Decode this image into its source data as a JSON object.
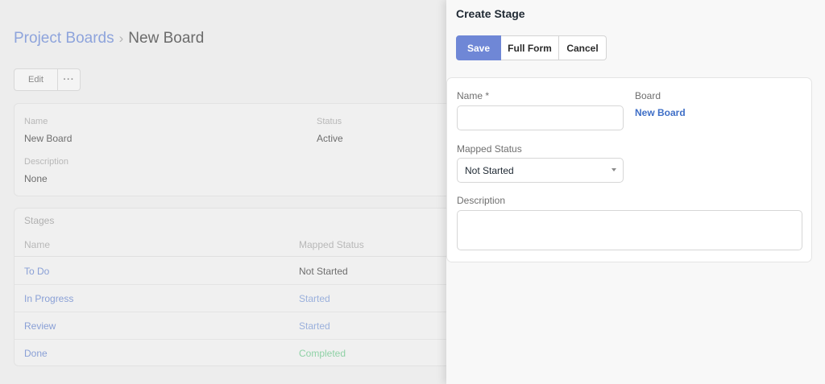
{
  "breadcrumb": {
    "parent": "Project Boards",
    "separator": "›",
    "current": "New Board"
  },
  "toolbar": {
    "edit_label": "Edit",
    "more_label": "···"
  },
  "details": {
    "name_label": "Name",
    "name_value": "New Board",
    "status_label": "Status",
    "status_value": "Active",
    "description_label": "Description",
    "description_value": "None"
  },
  "stages": {
    "title": "Stages",
    "columns": [
      "Name",
      "Mapped Status"
    ],
    "rows": [
      {
        "name": "To Do",
        "status": "Not Started",
        "status_color": "#6e6e6e"
      },
      {
        "name": "In Progress",
        "status": "Started",
        "status_color": "#9ab0dc"
      },
      {
        "name": "Review",
        "status": "Started",
        "status_color": "#9ab0dc"
      },
      {
        "name": "Done",
        "status": "Completed",
        "status_color": "#8fd1a6"
      }
    ]
  },
  "drawer": {
    "title": "Create Stage",
    "save_label": "Save",
    "full_form_label": "Full Form",
    "cancel_label": "Cancel",
    "name_label": "Name *",
    "name_value": "",
    "board_label": "Board",
    "board_value": "New Board",
    "mapped_status_label": "Mapped Status",
    "mapped_status_value": "Not Started",
    "description_label": "Description",
    "description_value": ""
  },
  "colors": {
    "accent": "#6f87d6",
    "link": "#3f6fc7"
  }
}
